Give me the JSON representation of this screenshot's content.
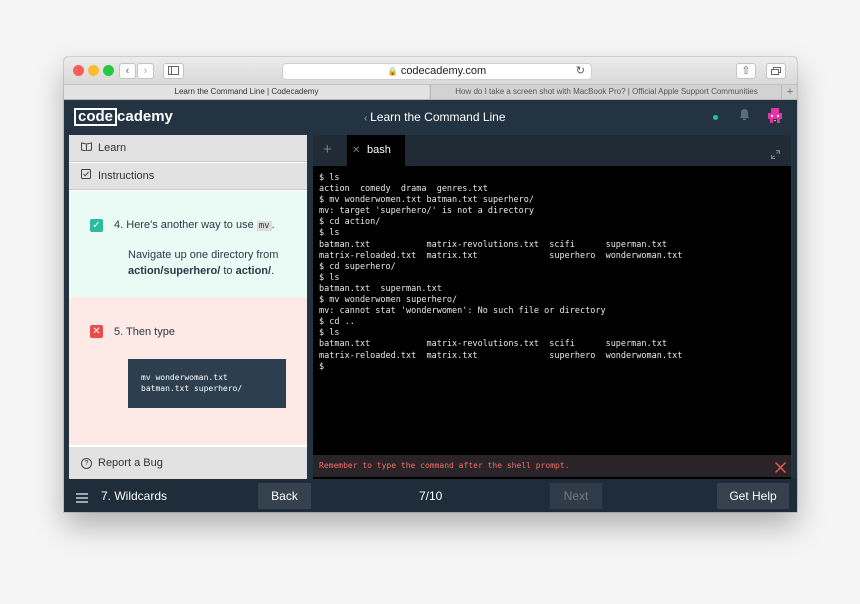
{
  "browser": {
    "url": "codecademy.com",
    "tabs": [
      {
        "label": "Learn the Command Line | Codecademy"
      },
      {
        "label": "How do I take a screen shot with MacBook Pro? | Official Apple Support Communities"
      }
    ],
    "new_tab_label": "+"
  },
  "header": {
    "logo_code": "code",
    "logo_cademy": "cademy",
    "course_title": "Learn the Command Line"
  },
  "sidebar": {
    "learn_label": "Learn",
    "instructions_label": "Instructions",
    "items": [
      {
        "number": "4.",
        "text_before": "Here's another way to use",
        "inline_code": "mv",
        "text_after": ".",
        "detail_before": "Navigate up one directory from",
        "detail_from": "action/superhero/",
        "detail_mid": "to",
        "detail_to": "action/",
        "detail_end": ".",
        "status": "complete"
      },
      {
        "number": "5.",
        "text": "Then type",
        "code": "mv wonderwoman.txt\nbatman.txt superhero/",
        "status": "incomplete"
      }
    ],
    "report_label": "Report a Bug"
  },
  "terminal": {
    "tab_label": "bash",
    "output": "$ ls\naction  comedy  drama  genres.txt\n$ mv wonderwomen.txt batman.txt superhero/\nmv: target 'superhero/' is not a directory\n$ cd action/\n$ ls\nbatman.txt           matrix-revolutions.txt  scifi      superman.txt\nmatrix-reloaded.txt  matrix.txt              superhero  wonderwoman.txt\n$ cd superhero/\n$ ls\nbatman.txt  superman.txt\n$ mv wonderwomen superhero/\nmv: cannot stat 'wonderwomen': No such file or directory\n$ cd ..\n$ ls\nbatman.txt           matrix-revolutions.txt  scifi      superman.txt\nmatrix-reloaded.txt  matrix.txt              superhero  wonderwoman.txt\n$",
    "hint": "Remember to type the command after the shell prompt."
  },
  "footer": {
    "lesson_label": "7. Wildcards",
    "back_label": "Back",
    "progress": "7/10",
    "next_label": "Next",
    "help_label": "Get Help"
  },
  "colors": {
    "brand_dark": "#233342",
    "success": "#2bbc9a",
    "error": "#ea4c4c",
    "status_dot": "#23c492",
    "avatar": "#e533a6"
  },
  "icons": [
    "back-icon",
    "forward-icon",
    "sidebar-icon",
    "lock-icon",
    "reload-icon",
    "share-icon",
    "tabs-icon",
    "book-icon",
    "checklist-icon",
    "check-icon",
    "x-icon",
    "question-icon",
    "plus-icon",
    "expand-icon",
    "close-icon",
    "menu-icon",
    "bell-icon",
    "avatar-icon"
  ]
}
